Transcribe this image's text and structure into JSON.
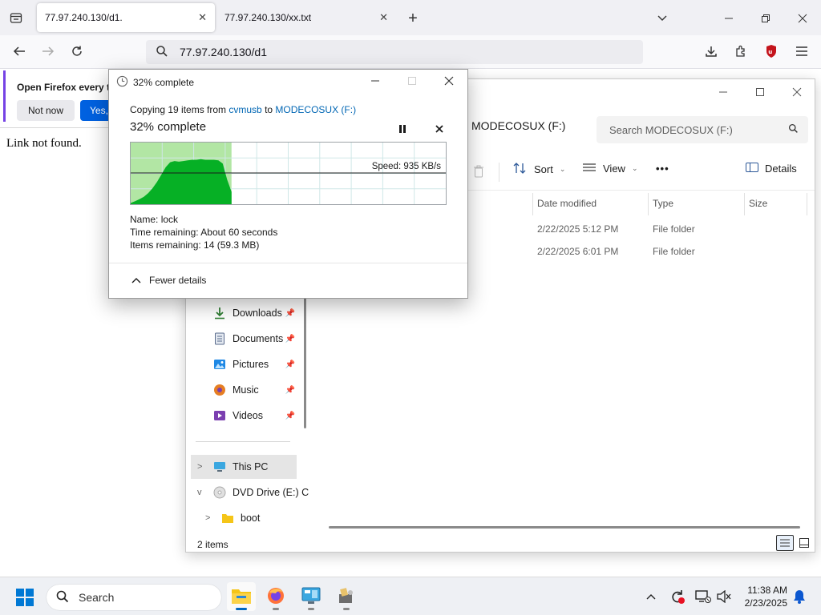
{
  "browser": {
    "tabs": [
      {
        "title": "77.97.240.130/d1.",
        "active": true
      },
      {
        "title": "77.97.240.130/xx.txt",
        "active": false
      }
    ],
    "url": "77.97.240.130/d1",
    "notification": {
      "title": "Open Firefox every ti",
      "not_now_label": "Not now",
      "yes_label": "Yes, c"
    },
    "page_text": "Link not found."
  },
  "explorer": {
    "address": "MODECOSUX (F:)",
    "search_placeholder": "Search MODECOSUX (F:)",
    "toolbar": {
      "sort_label": "Sort",
      "view_label": "View",
      "more_label": "•••",
      "details_label": "Details"
    },
    "columns": [
      "Date modified",
      "Type",
      "Size"
    ],
    "rows": [
      {
        "date": "2/22/2025 5:12 PM",
        "type": "File folder"
      },
      {
        "date": "2/22/2025 6:01 PM",
        "type": "File folder"
      }
    ],
    "nav": [
      {
        "label": "Downloads",
        "pinned": true,
        "color": "#2e7d32"
      },
      {
        "label": "Documents",
        "pinned": true,
        "color": "#5a6b8c"
      },
      {
        "label": "Pictures",
        "pinned": true,
        "color": "#1e88e5"
      },
      {
        "label": "Music",
        "pinned": true,
        "color": "#e67e22"
      },
      {
        "label": "Videos",
        "pinned": true,
        "color": "#7b3fb0"
      }
    ],
    "tree": [
      {
        "label": "This PC",
        "expander": ">",
        "selected": true
      },
      {
        "label": "DVD Drive (E:) C",
        "expander": "v",
        "selected": false
      },
      {
        "label": "boot",
        "expander": ">",
        "selected": false
      }
    ],
    "status": "2 items"
  },
  "copy_dialog": {
    "title": "32% complete",
    "copying_prefix": "Copying 19 items from ",
    "source": "cvmusb",
    "to_word": " to ",
    "destination": "MODECOSUX (F:)",
    "percent_text": "32% complete",
    "progress": 0.32,
    "speed": "Speed: 935 KB/s",
    "name_label": "Name:",
    "name_value": "lock",
    "time_label": "Time remaining:",
    "time_value": "About 60 seconds",
    "items_label": "Items remaining:",
    "items_value": "14 (59.3 MB)",
    "fewer_details_label": "Fewer details"
  },
  "taskbar": {
    "search_label": "Search",
    "time": "11:38 AM",
    "date": "2/23/2025"
  },
  "colors": {
    "accent": "#0067c0",
    "progress_green": "#06b025",
    "progress_light": "#b2e6a4",
    "firefox_blue": "#0061e0"
  }
}
